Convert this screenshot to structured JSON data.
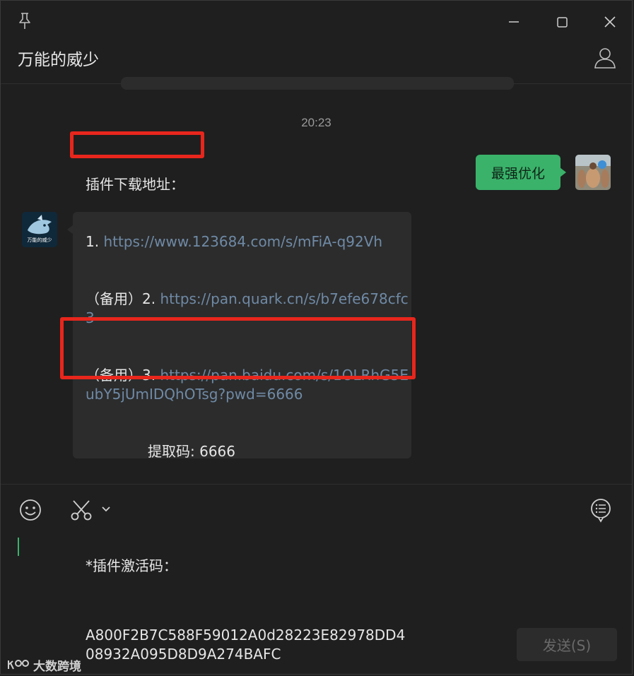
{
  "header": {
    "title": "万能的威少"
  },
  "chat": {
    "timestamp": "20:23",
    "my_message": "最强优化",
    "their_message": {
      "title": "插件下载地址：",
      "line1_prefix": "1. ",
      "line1_link": "https://www.123684.com/s/mFiA-q92Vh",
      "line2_prefix": "（备用）2. ",
      "line2_link": "https://pan.quark.cn/s/b7efe678cfc3",
      "line3_prefix": "（备用）3. ",
      "line3_link": "https://pan.baidu.com/s/1OLRhG5EubY5jUmIDQhOTsg?pwd=6666",
      "extract_code": "提取码: 6666",
      "activation_label": "*插件激活码：",
      "activation_code": "A800F2B7C588F59012A0d28223E82978DD408932A095D8D9A274BAFC"
    }
  },
  "input": {
    "send_label": "发送(S)"
  },
  "watermark": {
    "text": "大数跨境"
  },
  "colors": {
    "accent": "#3ab26a",
    "highlight": "#e8261c",
    "link": "#6f8aa6"
  }
}
